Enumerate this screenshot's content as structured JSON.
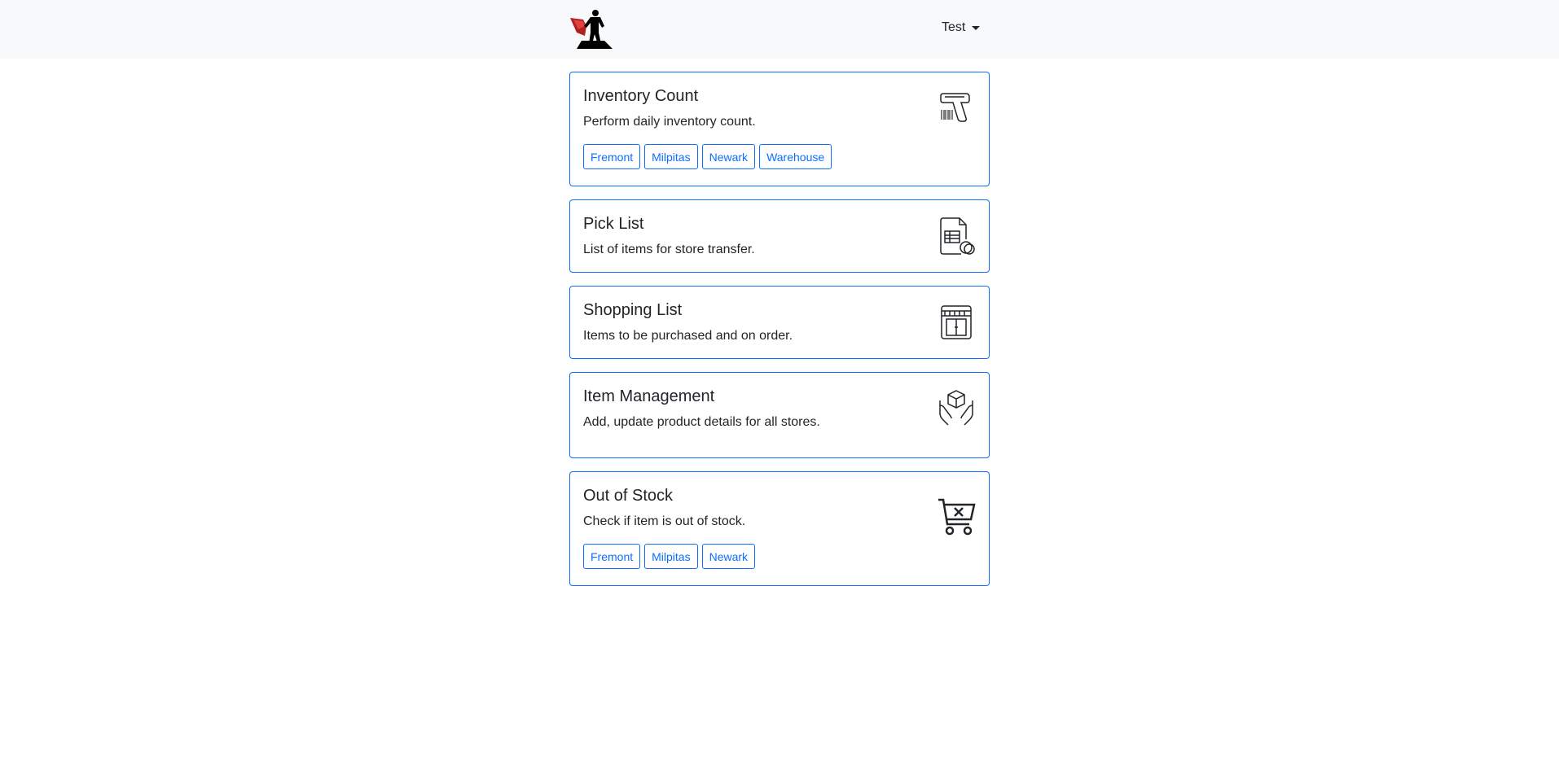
{
  "navbar": {
    "user_name": "Test"
  },
  "cards": [
    {
      "title": "Inventory Count",
      "text": "Perform daily inventory count.",
      "icon": "barcode-scanner-icon",
      "chips": [
        "Fremont",
        "Milpitas",
        "Newark",
        "Warehouse"
      ]
    },
    {
      "title": "Pick List",
      "text": "List of items for store transfer.",
      "icon": "document-coins-icon"
    },
    {
      "title": "Shopping List",
      "text": "Items to be purchased and on order.",
      "icon": "store-icon"
    },
    {
      "title": "Item Management",
      "text": "Add, update product details for all stores.",
      "icon": "hands-box-icon"
    },
    {
      "title": "Out of Stock",
      "text": "Check if item is out of stock.",
      "icon": "cart-x-icon",
      "chips": [
        "Fremont",
        "Milpitas",
        "Newark"
      ]
    }
  ],
  "colors": {
    "accent": "#0d6efd",
    "navbar_bg": "#f8f9fa",
    "text": "#212529"
  }
}
